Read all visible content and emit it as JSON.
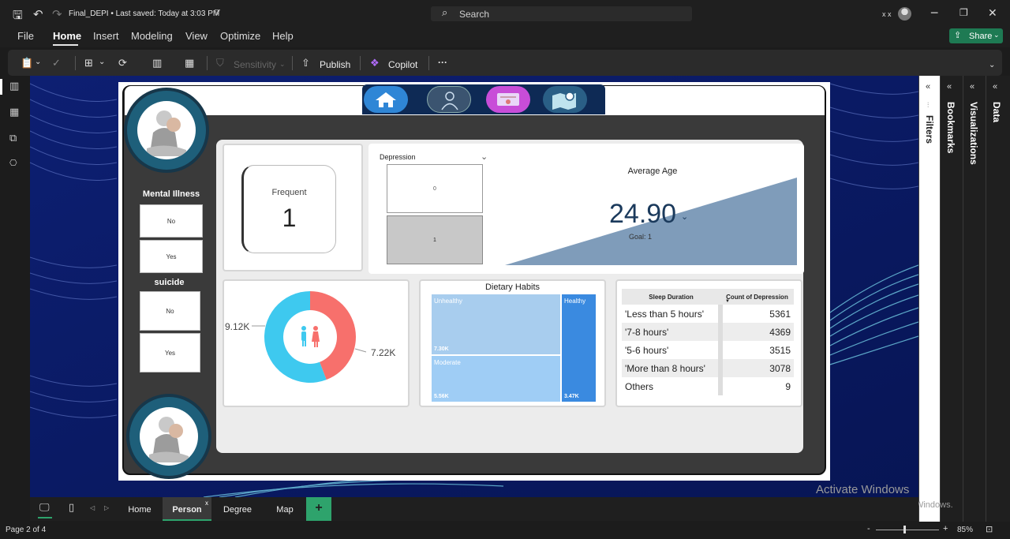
{
  "titlebar": {
    "doc_title": "Final_DEPI • Last saved: Today at 3:03 PM",
    "search_placeholder": "Search",
    "user_initials": "x x"
  },
  "menu": {
    "items": [
      "File",
      "Home",
      "Insert",
      "Modeling",
      "View",
      "Optimize",
      "Help"
    ],
    "share": "Share"
  },
  "ribbon": {
    "sensitivity": "Sensitivity",
    "publish": "Publish",
    "copilot": "Copilot",
    "more": "···"
  },
  "report": {
    "slicers": {
      "mental_illness": {
        "title": "Mental Illness",
        "options": [
          "No",
          "Yes"
        ]
      },
      "suicide": {
        "title": "suicide",
        "options": [
          "No",
          "Yes"
        ]
      }
    },
    "frequent_card": {
      "label": "Frequent",
      "value": "1"
    },
    "depression_slicer": {
      "title": "Depression",
      "options": [
        "0",
        "1"
      ]
    },
    "average_age": {
      "title": "Average Age",
      "value": "24.90",
      "goal": "Goal: 1"
    },
    "donut": {
      "left_label": "9.12K",
      "right_label": "7.22K",
      "colors": [
        "#3ec9ef",
        "#f7706c"
      ],
      "values": [
        9.12,
        7.22
      ]
    },
    "treemap": {
      "title": "Dietary Habits",
      "cells": [
        {
          "name": "Unhealthy",
          "value": "7.30K"
        },
        {
          "name": "Moderate",
          "value": "5.56K"
        },
        {
          "name": "Healthy",
          "value": "3.47K"
        }
      ]
    },
    "sleep_table": {
      "headers": [
        "Sleep Duration",
        "Count of Depression"
      ],
      "rows": [
        [
          "'Less than 5 hours'",
          "5361"
        ],
        [
          "'7-8 hours'",
          "4369"
        ],
        [
          "'5-6 hours'",
          "3515"
        ],
        [
          "'More than 8 hours'",
          "3078"
        ],
        [
          "Others",
          "9"
        ]
      ]
    }
  },
  "panes": [
    "Filters",
    "Bookmarks",
    "Visualizations",
    "Data"
  ],
  "tabs": [
    "Home",
    "Person",
    "Degree",
    "Map"
  ],
  "status": {
    "page": "Page 2 of 4",
    "zoom": "85%"
  },
  "watermark": {
    "line1": "Activate Windows",
    "line2": "Go to Settings to activate Windows."
  }
}
